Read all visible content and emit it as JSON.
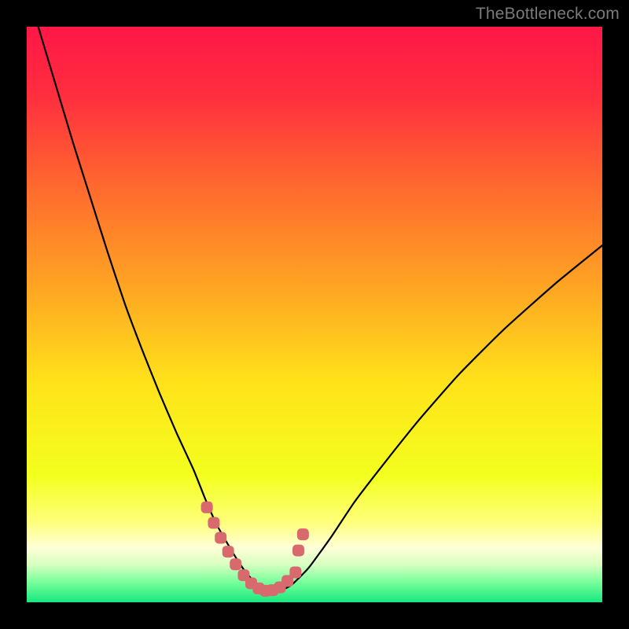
{
  "watermark": "TheBottleneck.com",
  "colors": {
    "bg": "#000000",
    "gradient_stops": [
      {
        "offset": 0.0,
        "color": "#ff1746"
      },
      {
        "offset": 0.12,
        "color": "#ff2e3f"
      },
      {
        "offset": 0.28,
        "color": "#ff6a2e"
      },
      {
        "offset": 0.45,
        "color": "#ffa423"
      },
      {
        "offset": 0.62,
        "color": "#ffe31a"
      },
      {
        "offset": 0.78,
        "color": "#f3ff1e"
      },
      {
        "offset": 0.86,
        "color": "#ffff7a"
      },
      {
        "offset": 0.905,
        "color": "#ffffd8"
      },
      {
        "offset": 0.935,
        "color": "#d6ffc1"
      },
      {
        "offset": 0.965,
        "color": "#78ff9b"
      },
      {
        "offset": 1.0,
        "color": "#17e87e"
      }
    ],
    "curve": "#000000",
    "marker": "#d86a6e"
  },
  "chart_data": {
    "type": "line",
    "title": "",
    "xlabel": "",
    "ylabel": "",
    "xlim": [
      0,
      100
    ],
    "ylim": [
      0,
      100
    ],
    "series": [
      {
        "name": "bottleneck-curve",
        "x": [
          2,
          5,
          8,
          11,
          14,
          17,
          20,
          23,
          26,
          29,
          31,
          33,
          35,
          36.5,
          38,
          39.5,
          41,
          42.5,
          44,
          46,
          49,
          53,
          57,
          62,
          68,
          75,
          83,
          92,
          100
        ],
        "y": [
          100,
          90,
          80,
          70.5,
          61,
          52,
          44,
          36.5,
          29.5,
          23,
          18,
          13.5,
          10,
          7.5,
          5.3,
          3.6,
          2.4,
          1.9,
          2.0,
          3.0,
          6.0,
          11.5,
          17.5,
          24,
          31.5,
          39.5,
          47.5,
          55.5,
          62
        ]
      }
    ],
    "markers": {
      "name": "highlighted-range",
      "x": [
        31.3,
        32.5,
        33.7,
        35.0,
        36.3,
        37.7,
        39.0,
        40.3,
        41.5,
        42.7,
        44.0,
        45.3,
        46.7,
        47.2,
        48.0
      ],
      "y": [
        16.5,
        13.8,
        11.2,
        8.8,
        6.6,
        4.7,
        3.3,
        2.4,
        2.0,
        2.1,
        2.6,
        3.7,
        5.2,
        9.0,
        11.8
      ]
    }
  }
}
